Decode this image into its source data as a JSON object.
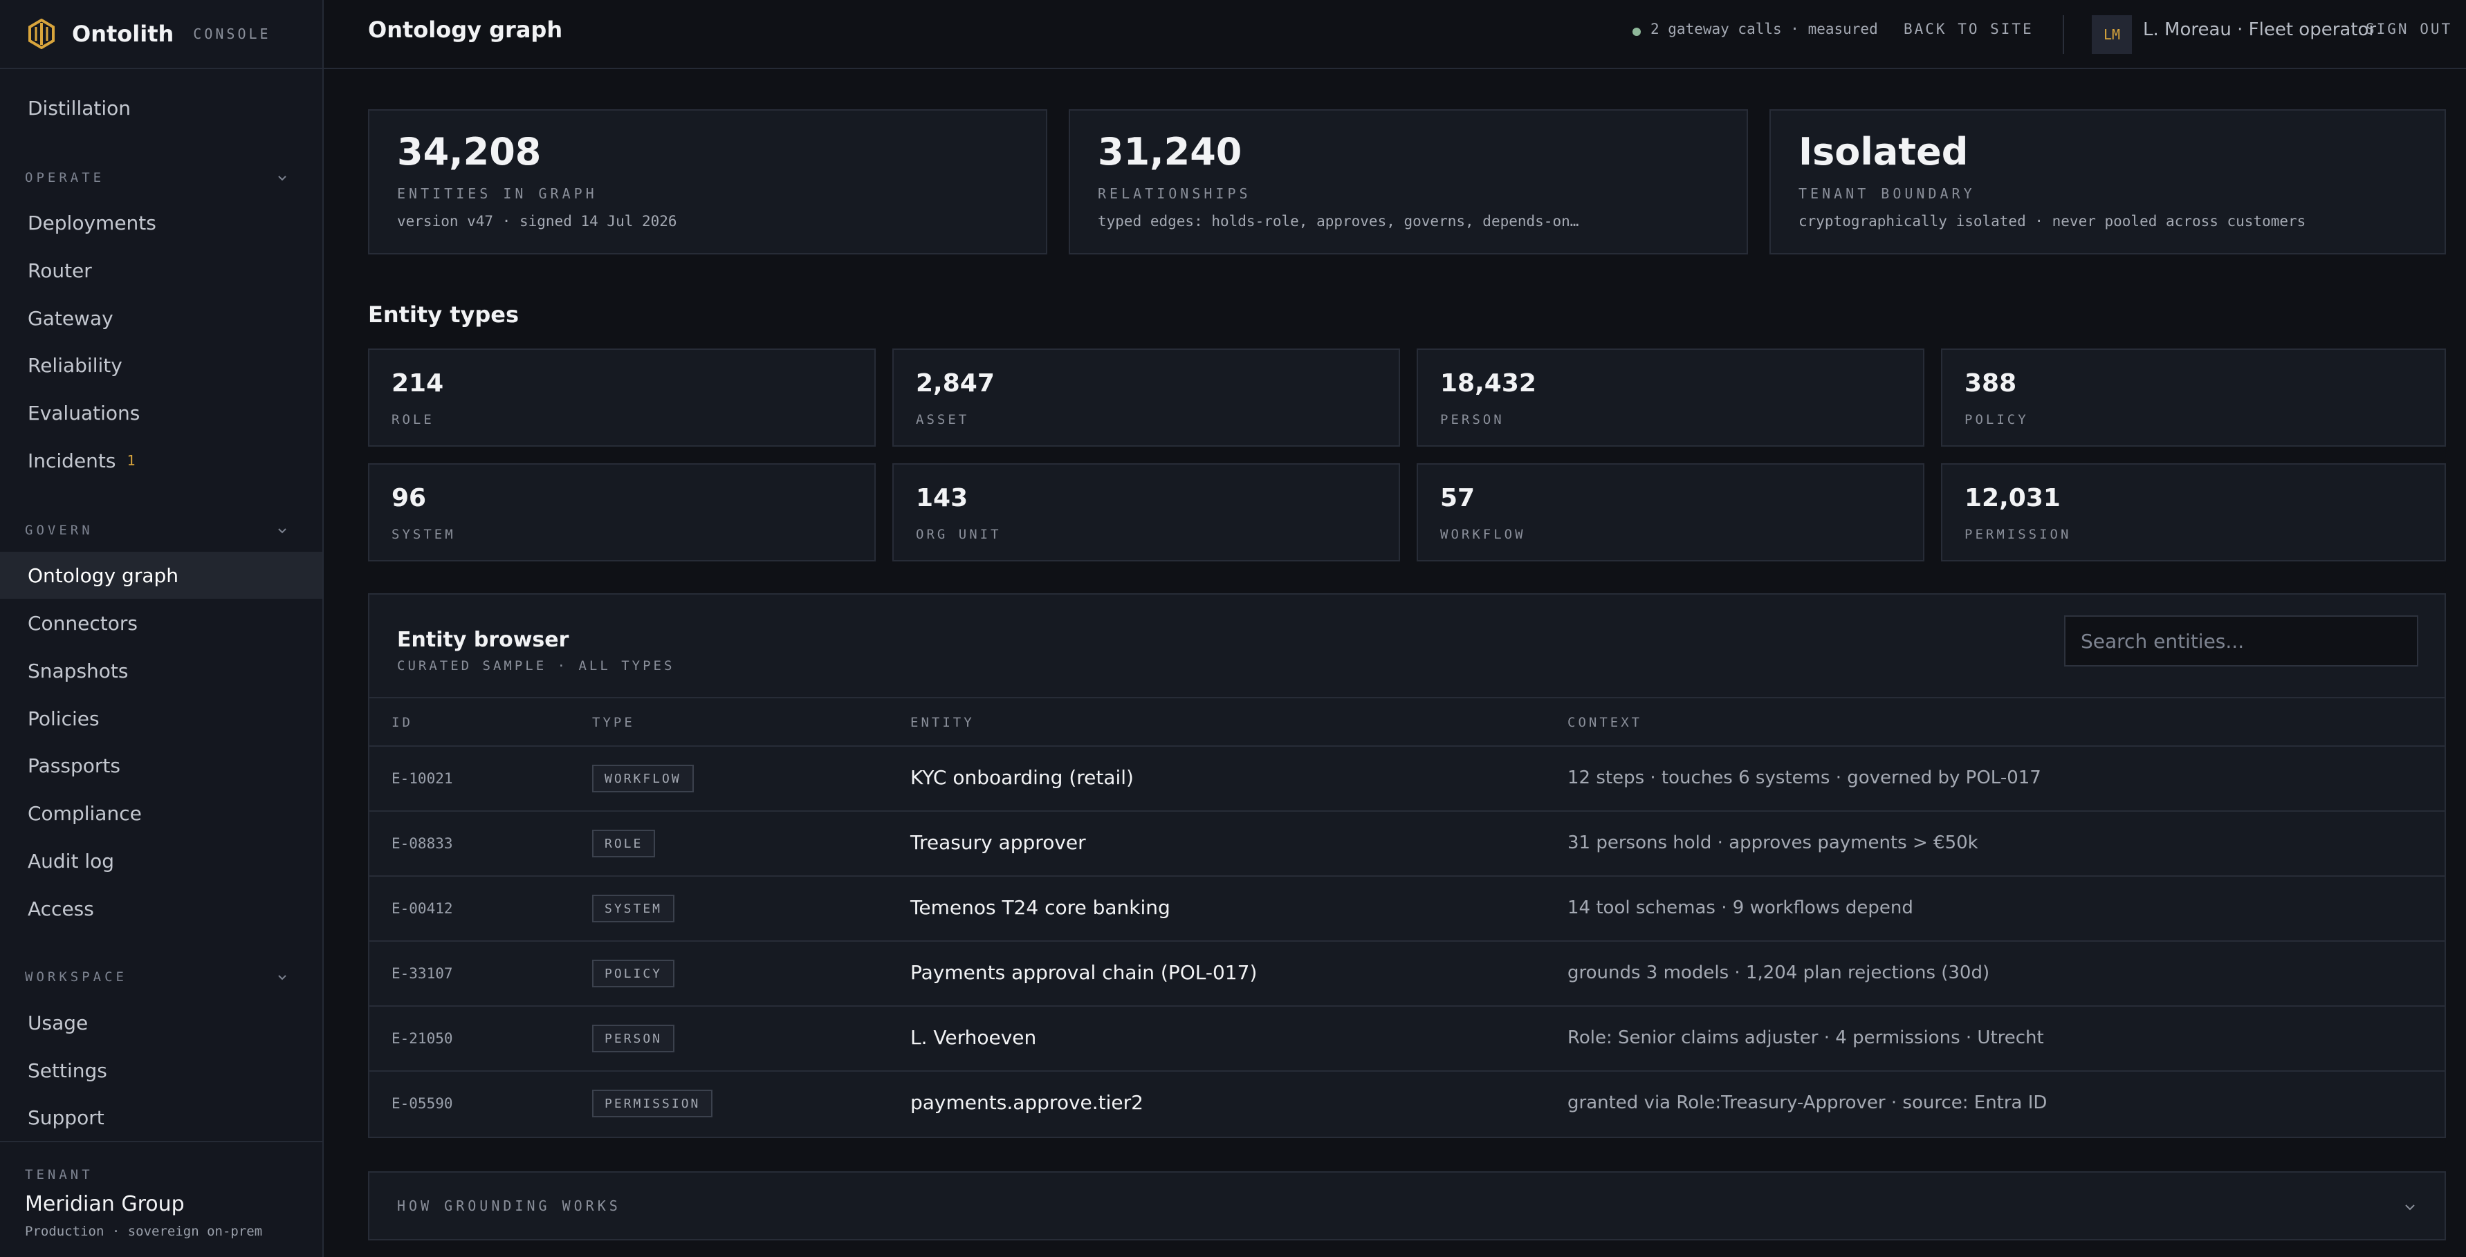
{
  "brand": {
    "name": "Ontolith",
    "console_label": "CONSOLE",
    "accent": "#d9a53c"
  },
  "sidebar": {
    "top_item": {
      "label": "Distillation"
    },
    "sections": [
      {
        "label": "OPERATE",
        "items": [
          {
            "label": "Deployments"
          },
          {
            "label": "Router"
          },
          {
            "label": "Gateway"
          },
          {
            "label": "Reliability"
          },
          {
            "label": "Evaluations"
          },
          {
            "label": "Incidents",
            "badge": "1"
          }
        ]
      },
      {
        "label": "GOVERN",
        "items": [
          {
            "label": "Ontology graph",
            "active": true
          },
          {
            "label": "Connectors"
          },
          {
            "label": "Snapshots"
          },
          {
            "label": "Policies"
          },
          {
            "label": "Passports"
          },
          {
            "label": "Compliance"
          },
          {
            "label": "Audit log"
          },
          {
            "label": "Access"
          }
        ]
      },
      {
        "label": "WORKSPACE",
        "items": [
          {
            "label": "Usage"
          },
          {
            "label": "Settings"
          },
          {
            "label": "Support"
          }
        ]
      }
    ],
    "tenant": {
      "label": "TENANT",
      "name": "Meridian Group",
      "env": "Production · sovereign on-prem"
    }
  },
  "topbar": {
    "title": "Ontology graph",
    "gateway_status": "2 gateway calls · measured",
    "back_label": "BACK TO SITE",
    "avatar_initials": "LM",
    "user": "L. Moreau · Fleet operator",
    "sign_out_label": "SIGN OUT"
  },
  "stats": [
    {
      "value": "34,208",
      "label": "ENTITIES IN GRAPH",
      "sub": "version v47 · signed 14 Jul 2026"
    },
    {
      "value": "31,240",
      "label": "RELATIONSHIPS",
      "sub": "typed edges: holds-role, approves, governs, depends-on…"
    },
    {
      "value": "Isolated",
      "label": "TENANT BOUNDARY",
      "sub": "cryptographically isolated · never pooled across customers"
    }
  ],
  "entity_types": {
    "title": "Entity types",
    "items": [
      {
        "count": "214",
        "name": "ROLE"
      },
      {
        "count": "2,847",
        "name": "ASSET"
      },
      {
        "count": "18,432",
        "name": "PERSON"
      },
      {
        "count": "388",
        "name": "POLICY"
      },
      {
        "count": "96",
        "name": "SYSTEM"
      },
      {
        "count": "143",
        "name": "ORG UNIT"
      },
      {
        "count": "57",
        "name": "WORKFLOW"
      },
      {
        "count": "12,031",
        "name": "PERMISSION"
      }
    ]
  },
  "browser": {
    "title": "Entity browser",
    "subtitle": "CURATED SAMPLE · ALL TYPES",
    "search_placeholder": "Search entities...",
    "columns": {
      "id": "ID",
      "type": "TYPE",
      "entity": "ENTITY",
      "context": "CONTEXT"
    },
    "rows": [
      {
        "id": "E-10021",
        "type": "WORKFLOW",
        "entity": "KYC onboarding (retail)",
        "context": "12 steps · touches 6 systems · governed by POL-017"
      },
      {
        "id": "E-08833",
        "type": "ROLE",
        "entity": "Treasury approver",
        "context": "31 persons hold · approves payments > €50k"
      },
      {
        "id": "E-00412",
        "type": "SYSTEM",
        "entity": "Temenos T24 core banking",
        "context": "14 tool schemas · 9 workflows depend"
      },
      {
        "id": "E-33107",
        "type": "POLICY",
        "entity": "Payments approval chain (POL-017)",
        "context": "grounds 3 models · 1,204 plan rejections (30d)"
      },
      {
        "id": "E-21050",
        "type": "PERSON",
        "entity": "L. Verhoeven",
        "context": "Role: Senior claims adjuster · 4 permissions · Utrecht"
      },
      {
        "id": "E-05590",
        "type": "PERMISSION",
        "entity": "payments.approve.tier2",
        "context": "granted via Role:Treasury-Approver · source: Entra ID"
      }
    ]
  },
  "grounding": {
    "label": "HOW GROUNDING WORKS"
  }
}
